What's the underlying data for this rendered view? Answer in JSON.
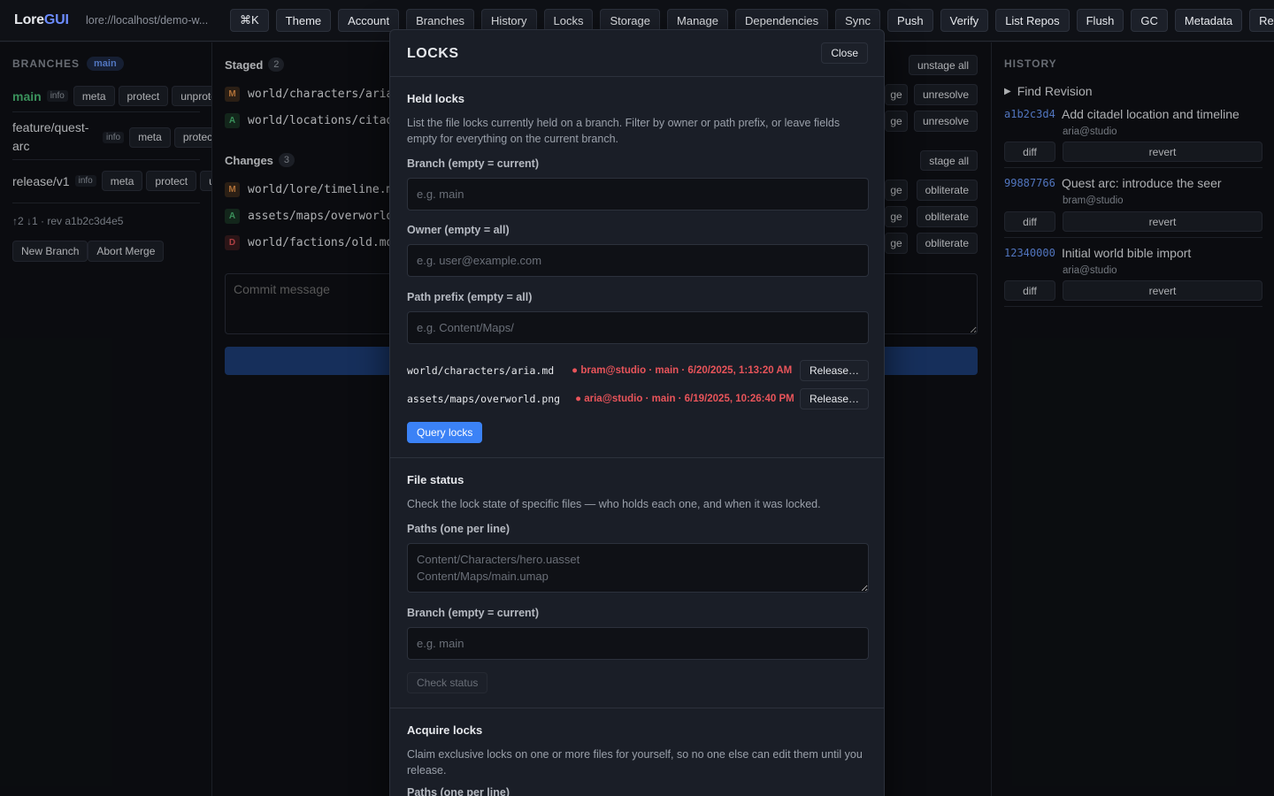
{
  "app": {
    "logo_main": "Lore",
    "logo_accent": "GUI",
    "repo_url": "lore://localhost/demo-w..."
  },
  "toolbar": [
    "⌘K",
    "Theme",
    "Account",
    "Branches",
    "History",
    "Locks",
    "Storage",
    "Manage",
    "Dependencies",
    "Sync",
    "Push",
    "Verify",
    "List Repos",
    "Flush",
    "GC",
    "Metadata",
    "Refresh"
  ],
  "sidebar": {
    "title": "BRANCHES",
    "current_pill": "main",
    "branches": [
      {
        "name": "main",
        "info": "info",
        "actions": [
          "meta",
          "protect",
          "unprote"
        ]
      },
      {
        "name_line1": "feature/quest-",
        "name_line2": "arc",
        "info": "info",
        "actions": [
          "meta",
          "protect"
        ]
      },
      {
        "name": "release/v1",
        "info": "info",
        "actions": [
          "meta",
          "protect",
          "ur"
        ]
      }
    ],
    "status": "↑2 ↓1 · rev a1b2c3d4e5",
    "buttons": [
      "New Branch",
      "Abort Merge"
    ]
  },
  "center": {
    "staged_title": "Staged",
    "staged_count": "2",
    "unstage_all": "unstage all",
    "staged_files": [
      {
        "status": "M",
        "path": "world/characters/aria.m",
        "btn_partial": "ge",
        "btn": "unresolve"
      },
      {
        "status": "A",
        "path": "world/locations/citade",
        "btn_partial": "ge",
        "btn": "unresolve"
      }
    ],
    "changes_title": "Changes",
    "changes_count": "3",
    "stage_all": "stage all",
    "changes_files": [
      {
        "status": "M",
        "path": "world/lore/timeline.md",
        "btn_partial": "ge",
        "btn": "obliterate"
      },
      {
        "status": "A",
        "path": "assets/maps/overworld.p",
        "btn_partial": "ge",
        "btn": "obliterate"
      },
      {
        "status": "D",
        "path": "world/factions/old.md",
        "btn_partial": "ge",
        "btn": "obliterate"
      }
    ],
    "commit_placeholder": "Commit message"
  },
  "history": {
    "title": "HISTORY",
    "find_revision": "Find Revision",
    "entries": [
      {
        "hash": "a1b2c3d4",
        "message": "Add citadel location and timeline",
        "author": "aria@studio",
        "diff": "diff",
        "revert": "revert"
      },
      {
        "hash": "99887766",
        "message": "Quest arc: introduce the seer",
        "author": "bram@studio",
        "diff": "diff",
        "revert": "revert"
      },
      {
        "hash": "12340000",
        "message": "Initial world bible import",
        "author": "aria@studio",
        "diff": "diff",
        "revert": "revert"
      }
    ]
  },
  "modal": {
    "title": "LOCKS",
    "close": "Close",
    "held": {
      "heading": "Held locks",
      "description": "List the file locks currently held on a branch. Filter by owner or path prefix, or leave fields empty for everything on the current branch.",
      "branch_label": "Branch (empty = current)",
      "branch_placeholder": "e.g. main",
      "owner_label": "Owner (empty = all)",
      "owner_placeholder": "e.g. user@example.com",
      "path_label": "Path prefix (empty = all)",
      "path_placeholder": "e.g. Content/Maps/",
      "locks": [
        {
          "path": "world/characters/aria.md",
          "meta": "● bram@studio · main · 6/20/2025, 1:13:20 AM",
          "release": "Release…"
        },
        {
          "path": "assets/maps/overworld.png",
          "meta": "● aria@studio · main · 6/19/2025, 10:26:40 PM",
          "release": "Release…"
        }
      ],
      "query_button": "Query locks"
    },
    "file_status": {
      "heading": "File status",
      "description": "Check the lock state of specific files — who holds each one, and when it was locked.",
      "paths_label": "Paths (one per line)",
      "paths_placeholder": "Content/Characters/hero.uasset\nContent/Maps/main.umap",
      "branch_label": "Branch (empty = current)",
      "branch_placeholder": "e.g. main",
      "check_button": "Check status"
    },
    "acquire": {
      "heading": "Acquire locks",
      "description": "Claim exclusive locks on one or more files for yourself, so no one else can edit them until you release.",
      "paths_label": "Paths (one per line)"
    }
  }
}
